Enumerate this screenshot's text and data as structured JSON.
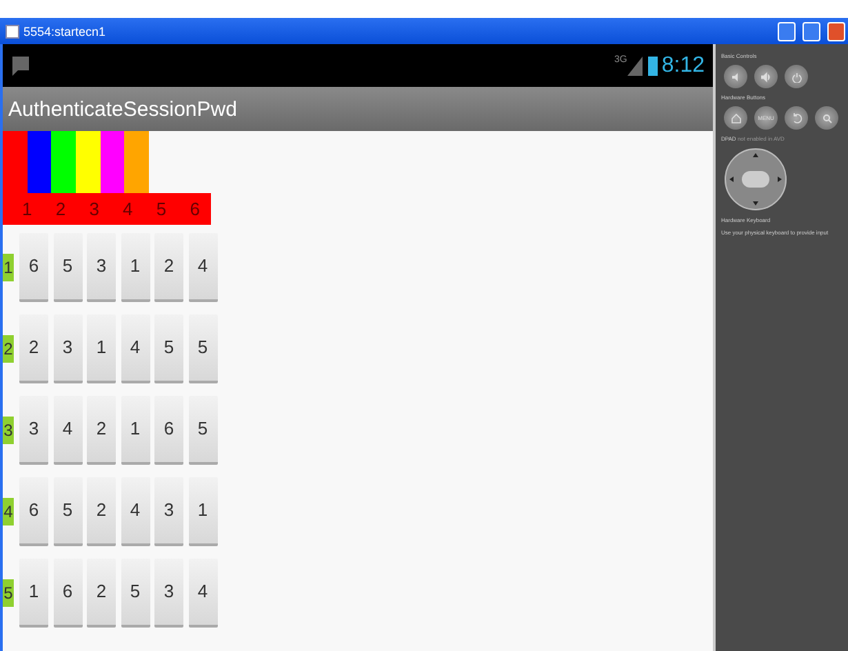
{
  "window": {
    "title": "5554:startecn1"
  },
  "status_bar": {
    "network": "3G",
    "time": "8:12"
  },
  "action_bar": {
    "title": "AuthenticateSessionPwd"
  },
  "color_strip": [
    {
      "color": "#ff0000"
    },
    {
      "color": "#0000ff"
    },
    {
      "color": "#00ff00"
    },
    {
      "color": "#ffff00"
    },
    {
      "color": "#ff00ff"
    },
    {
      "color": "#ffa500"
    }
  ],
  "column_numbers": [
    "1",
    "2",
    "3",
    "4",
    "5",
    "6"
  ],
  "rows": [
    {
      "label": "1",
      "buttons": [
        "6",
        "5",
        "3",
        "1",
        "2",
        "4"
      ]
    },
    {
      "label": "2",
      "buttons": [
        "2",
        "3",
        "1",
        "4",
        "5",
        "5"
      ]
    },
    {
      "label": "3",
      "buttons": [
        "3",
        "4",
        "2",
        "1",
        "6",
        "5"
      ]
    },
    {
      "label": "4",
      "buttons": [
        "6",
        "5",
        "2",
        "4",
        "3",
        "1"
      ]
    },
    {
      "label": "5",
      "buttons": [
        "1",
        "6",
        "2",
        "5",
        "3",
        "4"
      ]
    }
  ],
  "side_panel": {
    "basic_controls": "Basic Controls",
    "hardware_buttons": "Hardware Buttons",
    "menu_button": "MENU",
    "dpad_label": "DPAD",
    "dpad_note": "not enabled in AVD",
    "keyboard_title": "Hardware Keyboard",
    "keyboard_note": "Use your physical keyboard to provide input"
  }
}
